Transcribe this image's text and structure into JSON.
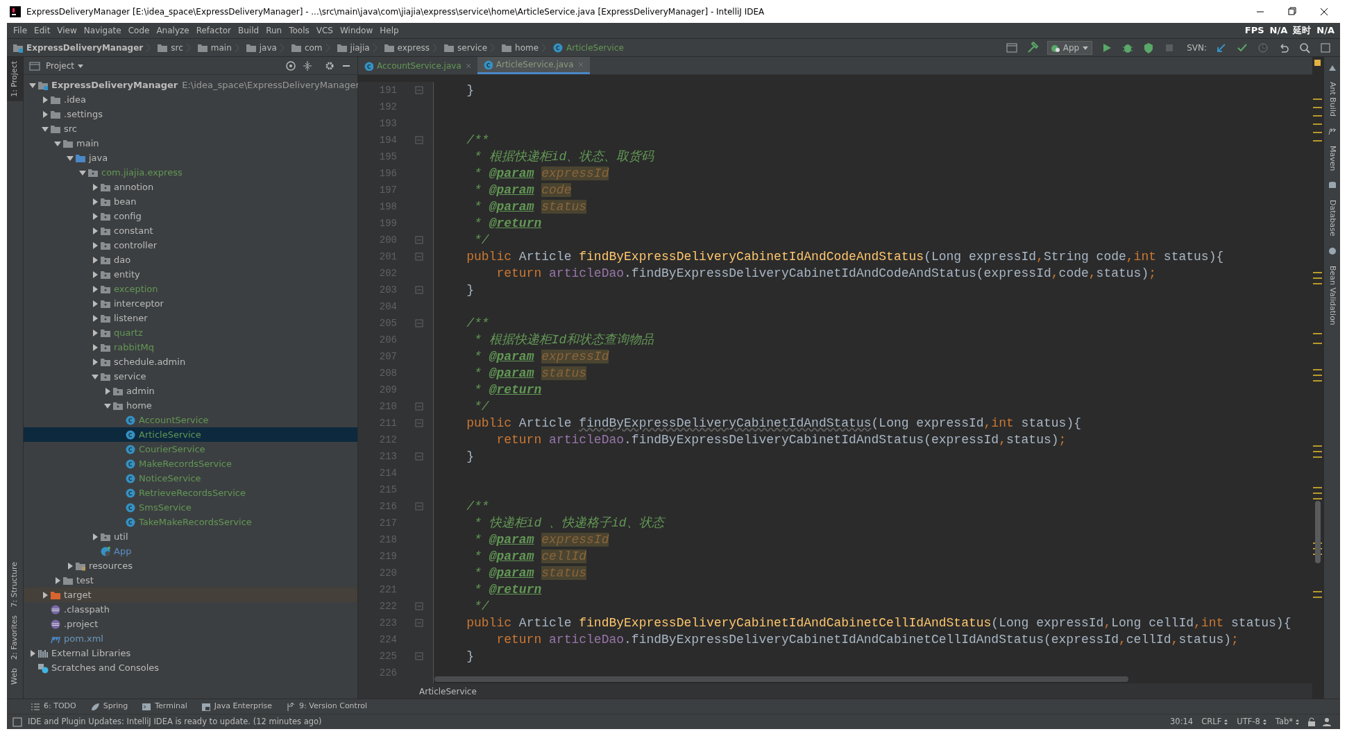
{
  "window": {
    "title": "ExpressDeliveryManager [E:\\idea_space\\ExpressDeliveryManager] - ...\\src\\main\\java\\com\\jiajia\\express\\service\\home\\ArticleService.java [ExpressDeliveryManager] - IntelliJ IDEA"
  },
  "menu": [
    "File",
    "Edit",
    "View",
    "Navigate",
    "Code",
    "Analyze",
    "Refactor",
    "Build",
    "Run",
    "Tools",
    "VCS",
    "Window",
    "Help"
  ],
  "overlay_stats": [
    "FPS",
    "N/A",
    "延时",
    "N/A"
  ],
  "breadcrumbs": [
    {
      "label": "ExpressDeliveryManager",
      "kind": "module"
    },
    {
      "label": "src",
      "kind": "folder"
    },
    {
      "label": "main",
      "kind": "folder"
    },
    {
      "label": "java",
      "kind": "folder"
    },
    {
      "label": "com",
      "kind": "folder"
    },
    {
      "label": "jiajia",
      "kind": "folder"
    },
    {
      "label": "express",
      "kind": "folder"
    },
    {
      "label": "service",
      "kind": "folder"
    },
    {
      "label": "home",
      "kind": "folder"
    },
    {
      "label": "ArticleService",
      "kind": "class"
    }
  ],
  "run_config": "App",
  "svn_label": "SVN:",
  "left_tool_windows": [
    {
      "label": "1: Project",
      "selected": true
    },
    {
      "label": "7: Structure",
      "selected": false
    },
    {
      "label": "2: Favorites",
      "selected": false
    },
    {
      "label": "Web",
      "selected": false
    }
  ],
  "right_tool_windows": [
    "Ant Build",
    "Maven",
    "Database",
    "Bean Validation"
  ],
  "project_panel": {
    "title": "Project",
    "tree": [
      {
        "label": "ExpressDeliveryManager",
        "path": "E:\\idea_space\\ExpressDeliveryManager",
        "kind": "module",
        "expanded": true,
        "selected": false,
        "children": [
          {
            "label": ".idea",
            "kind": "folder",
            "expanded": false,
            "selected": false
          },
          {
            "label": ".settings",
            "kind": "folder",
            "expanded": false,
            "selected": false
          },
          {
            "label": "src",
            "kind": "folder",
            "expanded": true,
            "selected": false,
            "children": [
              {
                "label": "main",
                "kind": "folder",
                "expanded": true,
                "selected": false,
                "children": [
                  {
                    "label": "java",
                    "kind": "source-folder",
                    "expanded": true,
                    "selected": false,
                    "children": [
                      {
                        "label": "com.jiajia.express",
                        "kind": "package",
                        "color": "#629755",
                        "expanded": true,
                        "selected": false,
                        "children": [
                          {
                            "label": "annotion",
                            "kind": "package",
                            "expanded": false,
                            "selected": false
                          },
                          {
                            "label": "bean",
                            "kind": "package",
                            "expanded": false,
                            "selected": false
                          },
                          {
                            "label": "config",
                            "kind": "package",
                            "expanded": false,
                            "selected": false
                          },
                          {
                            "label": "constant",
                            "kind": "package",
                            "expanded": false,
                            "selected": false
                          },
                          {
                            "label": "controller",
                            "kind": "package",
                            "expanded": false,
                            "selected": false
                          },
                          {
                            "label": "dao",
                            "kind": "package",
                            "expanded": false,
                            "selected": false
                          },
                          {
                            "label": "entity",
                            "kind": "package",
                            "expanded": false,
                            "selected": false
                          },
                          {
                            "label": "exception",
                            "kind": "package",
                            "color": "#629755",
                            "expanded": false,
                            "selected": false
                          },
                          {
                            "label": "interceptor",
                            "kind": "package",
                            "expanded": false,
                            "selected": false
                          },
                          {
                            "label": "listener",
                            "kind": "package",
                            "expanded": false,
                            "selected": false
                          },
                          {
                            "label": "quartz",
                            "kind": "package",
                            "color": "#629755",
                            "expanded": false,
                            "selected": false
                          },
                          {
                            "label": "rabbitMq",
                            "kind": "package",
                            "color": "#629755",
                            "expanded": false,
                            "selected": false
                          },
                          {
                            "label": "schedule.admin",
                            "kind": "package",
                            "expanded": false,
                            "selected": false
                          },
                          {
                            "label": "service",
                            "kind": "package",
                            "expanded": true,
                            "selected": false,
                            "children": [
                              {
                                "label": "admin",
                                "kind": "package",
                                "expanded": false,
                                "selected": false
                              },
                              {
                                "label": "home",
                                "kind": "package",
                                "expanded": true,
                                "selected": false,
                                "children": [
                                  {
                                    "label": "AccountService",
                                    "kind": "class",
                                    "selected": false
                                  },
                                  {
                                    "label": "ArticleService",
                                    "kind": "class",
                                    "selected": true
                                  },
                                  {
                                    "label": "CourierService",
                                    "kind": "class",
                                    "selected": false
                                  },
                                  {
                                    "label": "MakeRecordsService",
                                    "kind": "class",
                                    "selected": false
                                  },
                                  {
                                    "label": "NoticeService",
                                    "kind": "class",
                                    "selected": false
                                  },
                                  {
                                    "label": "RetrieveRecordsService",
                                    "kind": "class",
                                    "selected": false
                                  },
                                  {
                                    "label": "SmsService",
                                    "kind": "class",
                                    "selected": false
                                  },
                                  {
                                    "label": "TakeMakeRecordsService",
                                    "kind": "class",
                                    "selected": false
                                  }
                                ]
                              }
                            ]
                          },
                          {
                            "label": "util",
                            "kind": "package",
                            "expanded": false,
                            "selected": false
                          },
                          {
                            "label": "App",
                            "kind": "app-class",
                            "color": "#5c8fc7",
                            "selected": false
                          }
                        ]
                      }
                    ]
                  },
                  {
                    "label": "resources",
                    "kind": "resources-folder",
                    "expanded": false,
                    "selected": false
                  }
                ]
              },
              {
                "label": "test",
                "kind": "folder",
                "expanded": false,
                "selected": false
              }
            ]
          },
          {
            "label": "target",
            "kind": "excluded-folder",
            "expanded": false,
            "selected": false
          },
          {
            "label": ".classpath",
            "kind": "eclipse-file",
            "selected": false
          },
          {
            "label": ".project",
            "kind": "eclipse-file",
            "selected": false
          },
          {
            "label": "pom.xml",
            "kind": "maven-file",
            "color": "#6897bb",
            "selected": false
          }
        ]
      },
      {
        "label": "External Libraries",
        "kind": "libraries",
        "expanded": false,
        "selected": false
      },
      {
        "label": "Scratches and Consoles",
        "kind": "scratches",
        "selected": false
      }
    ]
  },
  "editor": {
    "tabs": [
      {
        "label": "AccountService.java",
        "selected": false
      },
      {
        "label": "ArticleService.java",
        "selected": true
      }
    ],
    "lines": [
      {
        "number": "191",
        "fold": true,
        "tokens": [
          {
            "kind": "plain",
            "text": "    }"
          }
        ]
      },
      {
        "number": "192",
        "fold": false
      },
      {
        "number": "193",
        "fold": false
      },
      {
        "number": "194",
        "fold": true,
        "tokens": [
          {
            "kind": "comment",
            "text": "    /**"
          }
        ]
      },
      {
        "number": "195",
        "fold": false,
        "tokens": [
          {
            "kind": "comment",
            "text": "     * 根据快递柜id、状态、取货码"
          }
        ]
      },
      {
        "number": "196",
        "fold": false,
        "tokens": [
          {
            "kind": "comment",
            "text": "     * "
          },
          {
            "kind": "doc-tag",
            "text": "@param"
          },
          {
            "kind": "param-ref",
            "text": " expressId"
          }
        ]
      },
      {
        "number": "197",
        "fold": false,
        "tokens": [
          {
            "kind": "comment",
            "text": "     * "
          },
          {
            "kind": "doc-tag",
            "text": "@param"
          },
          {
            "kind": "param-ref",
            "text": " code"
          }
        ]
      },
      {
        "number": "198",
        "fold": false,
        "tokens": [
          {
            "kind": "comment",
            "text": "     * "
          },
          {
            "kind": "doc-tag",
            "text": "@param"
          },
          {
            "kind": "param-ref",
            "text": " status"
          }
        ]
      },
      {
        "number": "199",
        "fold": false,
        "tokens": [
          {
            "kind": "comment",
            "text": "     * "
          },
          {
            "kind": "doc-tag",
            "text": "@return"
          }
        ]
      },
      {
        "number": "200",
        "fold": true,
        "tokens": [
          {
            "kind": "comment",
            "text": "     */"
          }
        ]
      },
      {
        "number": "201",
        "fold": true,
        "tokens": [
          {
            "kind": "keyword",
            "text": "    public "
          },
          {
            "kind": "plain",
            "text": "Article "
          },
          {
            "kind": "method",
            "text": "findByExpressDeliveryCabinetIdAndCodeAndStatus"
          },
          {
            "kind": "plain",
            "text": "(Long expressId"
          },
          {
            "kind": "keyword",
            "text": ","
          },
          {
            "kind": "plain",
            "text": "String code"
          },
          {
            "kind": "keyword",
            "text": ",int "
          },
          {
            "kind": "plain",
            "text": "status){"
          }
        ]
      },
      {
        "number": "202",
        "fold": false,
        "tokens": [
          {
            "kind": "keyword",
            "text": "        return "
          },
          {
            "kind": "field",
            "text": "articleDao"
          },
          {
            "kind": "plain",
            "text": ".findByExpressDeliveryCabinetIdAndCodeAndStatus(expressId"
          },
          {
            "kind": "keyword",
            "text": ","
          },
          {
            "kind": "plain",
            "text": "code"
          },
          {
            "kind": "keyword",
            "text": ","
          },
          {
            "kind": "plain",
            "text": "status)"
          },
          {
            "kind": "keyword",
            "text": ";"
          }
        ]
      },
      {
        "number": "203",
        "fold": true,
        "tokens": [
          {
            "kind": "plain",
            "text": "    }"
          }
        ]
      },
      {
        "number": "204",
        "fold": false
      },
      {
        "number": "205",
        "fold": true,
        "tokens": [
          {
            "kind": "comment",
            "text": "    /**"
          }
        ]
      },
      {
        "number": "206",
        "fold": false,
        "tokens": [
          {
            "kind": "comment",
            "text": "     * 根据快递柜Id和状态查询物品"
          }
        ]
      },
      {
        "number": "207",
        "fold": false,
        "tokens": [
          {
            "kind": "comment",
            "text": "     * "
          },
          {
            "kind": "doc-tag",
            "text": "@param"
          },
          {
            "kind": "param-ref",
            "text": " expressId"
          }
        ]
      },
      {
        "number": "208",
        "fold": false,
        "tokens": [
          {
            "kind": "comment",
            "text": "     * "
          },
          {
            "kind": "doc-tag",
            "text": "@param"
          },
          {
            "kind": "param-ref",
            "text": " status"
          }
        ]
      },
      {
        "number": "209",
        "fold": false,
        "tokens": [
          {
            "kind": "comment",
            "text": "     * "
          },
          {
            "kind": "doc-tag",
            "text": "@return"
          }
        ]
      },
      {
        "number": "210",
        "fold": true,
        "tokens": [
          {
            "kind": "comment",
            "text": "     */"
          }
        ]
      },
      {
        "number": "211",
        "fold": true,
        "tokens": [
          {
            "kind": "keyword",
            "text": "    public "
          },
          {
            "kind": "plain",
            "text": "Article "
          },
          {
            "kind": "unused-method",
            "text": "findByExpressDeliveryCabinetIdAndStatus"
          },
          {
            "kind": "plain",
            "text": "(Long expressId"
          },
          {
            "kind": "keyword",
            "text": ",int "
          },
          {
            "kind": "plain",
            "text": "status){"
          }
        ]
      },
      {
        "number": "212",
        "fold": false,
        "tokens": [
          {
            "kind": "keyword",
            "text": "        return "
          },
          {
            "kind": "field",
            "text": "articleDao"
          },
          {
            "kind": "plain",
            "text": ".findByExpressDeliveryCabinetIdAndStatus(expressId"
          },
          {
            "kind": "keyword",
            "text": ","
          },
          {
            "kind": "plain",
            "text": "status)"
          },
          {
            "kind": "keyword",
            "text": ";"
          }
        ]
      },
      {
        "number": "213",
        "fold": true,
        "tokens": [
          {
            "kind": "plain",
            "text": "    }"
          }
        ]
      },
      {
        "number": "214",
        "fold": false
      },
      {
        "number": "215",
        "fold": false
      },
      {
        "number": "216",
        "fold": true,
        "tokens": [
          {
            "kind": "comment",
            "text": "    /**"
          }
        ]
      },
      {
        "number": "217",
        "fold": false,
        "tokens": [
          {
            "kind": "comment",
            "text": "     * 快递柜id 、快递格子id、状态"
          }
        ]
      },
      {
        "number": "218",
        "fold": false,
        "tokens": [
          {
            "kind": "comment",
            "text": "     * "
          },
          {
            "kind": "doc-tag",
            "text": "@param"
          },
          {
            "kind": "param-ref",
            "text": " expressId"
          }
        ]
      },
      {
        "number": "219",
        "fold": false,
        "tokens": [
          {
            "kind": "comment",
            "text": "     * "
          },
          {
            "kind": "doc-tag",
            "text": "@param"
          },
          {
            "kind": "param-ref",
            "text": " cellId"
          }
        ]
      },
      {
        "number": "220",
        "fold": false,
        "tokens": [
          {
            "kind": "comment",
            "text": "     * "
          },
          {
            "kind": "doc-tag",
            "text": "@param"
          },
          {
            "kind": "param-ref",
            "text": " status"
          }
        ]
      },
      {
        "number": "221",
        "fold": false,
        "tokens": [
          {
            "kind": "comment",
            "text": "     * "
          },
          {
            "kind": "doc-tag",
            "text": "@return"
          }
        ]
      },
      {
        "number": "222",
        "fold": true,
        "tokens": [
          {
            "kind": "comment",
            "text": "     */"
          }
        ]
      },
      {
        "number": "223",
        "fold": true,
        "tokens": [
          {
            "kind": "keyword",
            "text": "    public "
          },
          {
            "kind": "plain",
            "text": "Article "
          },
          {
            "kind": "method",
            "text": "findByExpressDeliveryCabinetIdAndCabinetCellIdAndStatus"
          },
          {
            "kind": "plain",
            "text": "(Long expressId"
          },
          {
            "kind": "keyword",
            "text": ","
          },
          {
            "kind": "plain",
            "text": "Long cellId"
          },
          {
            "kind": "keyword",
            "text": ",int "
          },
          {
            "kind": "plain",
            "text": "status){"
          }
        ]
      },
      {
        "number": "224",
        "fold": false,
        "tokens": [
          {
            "kind": "keyword",
            "text": "        return "
          },
          {
            "kind": "field",
            "text": "articleDao"
          },
          {
            "kind": "plain",
            "text": ".findByExpressDeliveryCabinetIdAndCabinetCellIdAndStatus(expressId"
          },
          {
            "kind": "keyword",
            "text": ","
          },
          {
            "kind": "plain",
            "text": "cellId"
          },
          {
            "kind": "keyword",
            "text": ","
          },
          {
            "kind": "plain",
            "text": "status)"
          },
          {
            "kind": "keyword",
            "text": ";"
          }
        ]
      },
      {
        "number": "225",
        "fold": true,
        "tokens": [
          {
            "kind": "plain",
            "text": "    }"
          }
        ]
      },
      {
        "number": "226",
        "fold": false
      }
    ],
    "breadcrumb": "ArticleService"
  },
  "bottom_tool_windows": [
    {
      "label": "6: TODO",
      "kind": "todo"
    },
    {
      "label": "Spring",
      "kind": "spring"
    },
    {
      "label": "Terminal",
      "kind": "terminal"
    },
    {
      "label": "Java Enterprise",
      "kind": "enterprise"
    },
    {
      "label": "9: Version Control",
      "kind": "vcs"
    }
  ],
  "status_bar": {
    "message": "IDE and Plugin Updates: IntelliJ IDEA is ready to update. (12 minutes ago)",
    "position": "30:14",
    "line_separator": "CRLF",
    "encoding": "UTF-8",
    "indent": "Tab*"
  }
}
